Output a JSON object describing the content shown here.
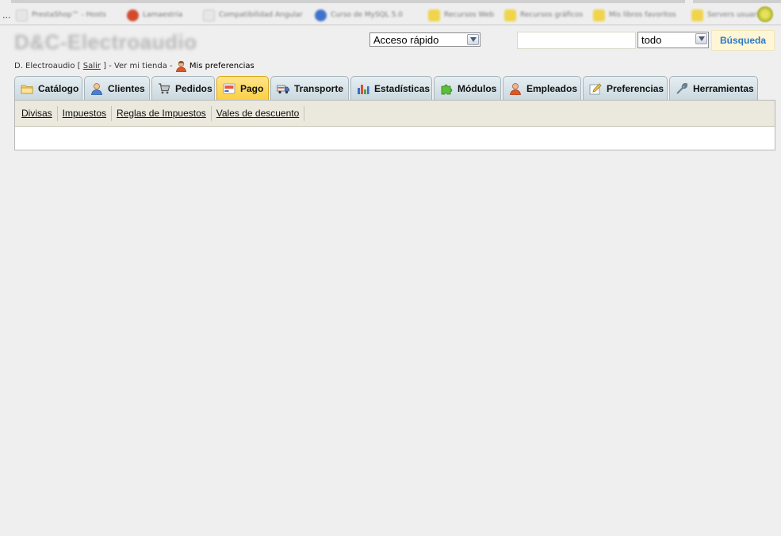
{
  "browser": {
    "ellipsis": "...",
    "bookmarks": [
      {
        "label": "PrestaShop™ - Hosts",
        "icon": "page-icon"
      },
      {
        "label": "Lamaestria",
        "icon": "red-circle-icon"
      },
      {
        "label": "Compatibilidad Angular",
        "icon": "page-icon"
      },
      {
        "label": "Curso de MySQL 5.0",
        "icon": "blue-globe-icon"
      },
      {
        "label": "Recursos Web",
        "icon": "folder-icon"
      },
      {
        "label": "Recursos gráficos",
        "icon": "folder-icon"
      },
      {
        "label": "Mis libros favoritos",
        "icon": "folder-icon"
      },
      {
        "label": "Servers usuarios",
        "icon": "folder-icon"
      }
    ]
  },
  "header": {
    "shop_title": "D&C-Electroaudio",
    "quick_access": "Acceso rápido",
    "search_value": "",
    "search_scope": "todo",
    "search_button": "Búsqueda"
  },
  "userline": {
    "user": "D. Electroaudio",
    "open_bracket": "[",
    "logout": "Salir",
    "close_bracket": "]",
    "sep1": "-",
    "view_store": "Ver mi tienda",
    "sep2": "-",
    "preferences": "Mis preferencias"
  },
  "tabs": [
    {
      "label": "Catálogo",
      "icon": "folder-icon",
      "active": false
    },
    {
      "label": "Clientes",
      "icon": "customer-icon",
      "active": false
    },
    {
      "label": "Pedidos",
      "icon": "cart-icon",
      "active": false
    },
    {
      "label": "Pago",
      "icon": "payment-card-icon",
      "active": true
    },
    {
      "label": "Transporte",
      "icon": "truck-icon",
      "active": false
    },
    {
      "label": "Estadísticas",
      "icon": "bar-chart-icon",
      "active": false
    },
    {
      "label": "Módulos",
      "icon": "puzzle-icon",
      "active": false
    },
    {
      "label": "Empleados",
      "icon": "employee-icon",
      "active": false
    },
    {
      "label": "Preferencias",
      "icon": "edit-icon",
      "active": false
    },
    {
      "label": "Herramientas",
      "icon": "wrench-icon",
      "active": false
    }
  ],
  "subnav": [
    {
      "label": "Divisas"
    },
    {
      "label": "Impuestos"
    },
    {
      "label": "Reglas de Impuestos"
    },
    {
      "label": "Vales de descuento"
    }
  ],
  "colors": {
    "active_tab": "#fbcf42",
    "tab": "#d4e1e7",
    "search_button_text": "#2a78c9",
    "subnav_bg": "#ebe8de"
  }
}
